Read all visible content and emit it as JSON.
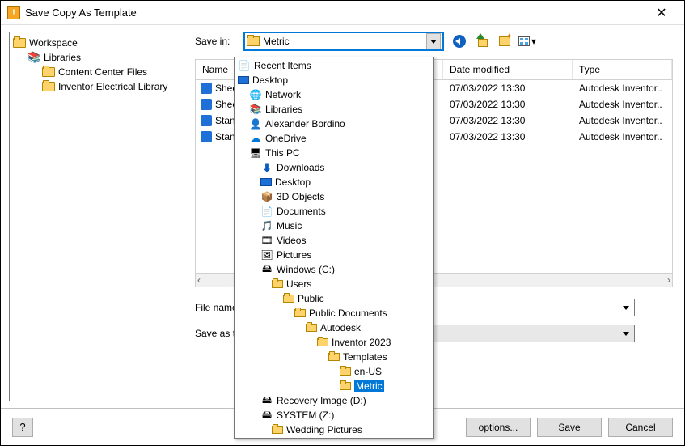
{
  "window": {
    "title": "Save Copy As Template"
  },
  "sidebar": {
    "items": [
      {
        "label": "Workspace",
        "icon": "folder",
        "indent": 0
      },
      {
        "label": "Libraries",
        "icon": "libraries",
        "indent": 1
      },
      {
        "label": "Content Center Files",
        "icon": "folder",
        "indent": 2
      },
      {
        "label": "Inventor Electrical Library",
        "icon": "folder",
        "indent": 2
      }
    ]
  },
  "savein": {
    "label": "Save in:",
    "value": "Metric"
  },
  "toolbar": {
    "back": "Back",
    "up": "Up One Level",
    "newfolder": "Create New Folder",
    "view": "View Menu"
  },
  "columns": {
    "name": "Name",
    "date": "Date modified",
    "type": "Type"
  },
  "files": [
    {
      "name": "Shee",
      "date": "07/03/2022 13:30",
      "type": "Autodesk Inventor.."
    },
    {
      "name": "Shee",
      "date": "07/03/2022 13:30",
      "type": "Autodesk Inventor.."
    },
    {
      "name": "Stan",
      "date": "07/03/2022 13:30",
      "type": "Autodesk Inventor.."
    },
    {
      "name": "Stan",
      "date": "07/03/2022 13:30",
      "type": "Autodesk Inventor.."
    }
  ],
  "filename": {
    "label": "File name"
  },
  "saveastype": {
    "label": "Save as ty"
  },
  "buttons": {
    "options": "options...",
    "save": "Save",
    "cancel": "Cancel",
    "help": "?"
  },
  "dropdown": [
    {
      "label": "Recent Items",
      "icon": "recent",
      "indent": 0
    },
    {
      "label": "Desktop",
      "icon": "desktop",
      "indent": 0
    },
    {
      "label": "Network",
      "icon": "network",
      "indent": 1
    },
    {
      "label": "Libraries",
      "icon": "libraries",
      "indent": 1
    },
    {
      "label": "Alexander Bordino",
      "icon": "user",
      "indent": 1
    },
    {
      "label": "OneDrive",
      "icon": "onedrive",
      "indent": 1
    },
    {
      "label": "This PC",
      "icon": "thispc",
      "indent": 1
    },
    {
      "label": "Downloads",
      "icon": "downloads",
      "indent": 2
    },
    {
      "label": "Desktop",
      "icon": "desktop",
      "indent": 2
    },
    {
      "label": "3D Objects",
      "icon": "3d",
      "indent": 2
    },
    {
      "label": "Documents",
      "icon": "documents",
      "indent": 2
    },
    {
      "label": "Music",
      "icon": "music",
      "indent": 2
    },
    {
      "label": "Videos",
      "icon": "videos",
      "indent": 2
    },
    {
      "label": "Pictures",
      "icon": "pictures",
      "indent": 2
    },
    {
      "label": "Windows (C:)",
      "icon": "drive",
      "indent": 2
    },
    {
      "label": "Users",
      "icon": "folder",
      "indent": 3
    },
    {
      "label": "Public",
      "icon": "folder",
      "indent": 4
    },
    {
      "label": "Public Documents",
      "icon": "folder",
      "indent": 5
    },
    {
      "label": "Autodesk",
      "icon": "folder",
      "indent": 6
    },
    {
      "label": "Inventor 2023",
      "icon": "folder",
      "indent": 7
    },
    {
      "label": "Templates",
      "icon": "folder",
      "indent": 8
    },
    {
      "label": "en-US",
      "icon": "folder",
      "indent": 9
    },
    {
      "label": "Metric",
      "icon": "folder",
      "indent": 9,
      "selected": true
    },
    {
      "label": "Recovery Image (D:)",
      "icon": "drive",
      "indent": 2
    },
    {
      "label": "SYSTEM (Z:)",
      "icon": "drive",
      "indent": 2
    },
    {
      "label": "Wedding Pictures",
      "icon": "folder",
      "indent": 3
    }
  ]
}
